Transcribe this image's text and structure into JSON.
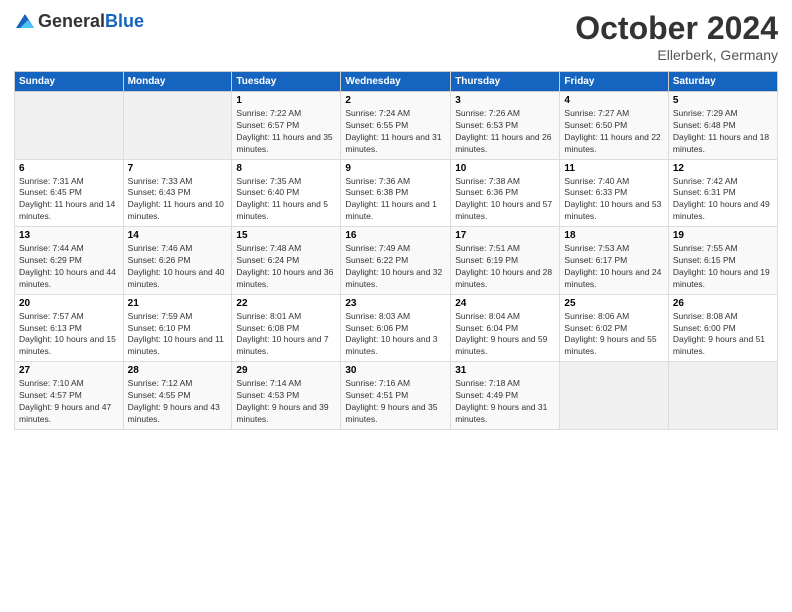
{
  "header": {
    "logo_general": "General",
    "logo_blue": "Blue",
    "month": "October 2024",
    "location": "Ellerberk, Germany"
  },
  "weekdays": [
    "Sunday",
    "Monday",
    "Tuesday",
    "Wednesday",
    "Thursday",
    "Friday",
    "Saturday"
  ],
  "weeks": [
    [
      {
        "day": "",
        "empty": true
      },
      {
        "day": "",
        "empty": true
      },
      {
        "day": "1",
        "sunrise": "7:22 AM",
        "sunset": "6:57 PM",
        "daylight": "11 hours and 35 minutes."
      },
      {
        "day": "2",
        "sunrise": "7:24 AM",
        "sunset": "6:55 PM",
        "daylight": "11 hours and 31 minutes."
      },
      {
        "day": "3",
        "sunrise": "7:26 AM",
        "sunset": "6:53 PM",
        "daylight": "11 hours and 26 minutes."
      },
      {
        "day": "4",
        "sunrise": "7:27 AM",
        "sunset": "6:50 PM",
        "daylight": "11 hours and 22 minutes."
      },
      {
        "day": "5",
        "sunrise": "7:29 AM",
        "sunset": "6:48 PM",
        "daylight": "11 hours and 18 minutes."
      }
    ],
    [
      {
        "day": "6",
        "sunrise": "7:31 AM",
        "sunset": "6:45 PM",
        "daylight": "11 hours and 14 minutes."
      },
      {
        "day": "7",
        "sunrise": "7:33 AM",
        "sunset": "6:43 PM",
        "daylight": "11 hours and 10 minutes."
      },
      {
        "day": "8",
        "sunrise": "7:35 AM",
        "sunset": "6:40 PM",
        "daylight": "11 hours and 5 minutes."
      },
      {
        "day": "9",
        "sunrise": "7:36 AM",
        "sunset": "6:38 PM",
        "daylight": "11 hours and 1 minute."
      },
      {
        "day": "10",
        "sunrise": "7:38 AM",
        "sunset": "6:36 PM",
        "daylight": "10 hours and 57 minutes."
      },
      {
        "day": "11",
        "sunrise": "7:40 AM",
        "sunset": "6:33 PM",
        "daylight": "10 hours and 53 minutes."
      },
      {
        "day": "12",
        "sunrise": "7:42 AM",
        "sunset": "6:31 PM",
        "daylight": "10 hours and 49 minutes."
      }
    ],
    [
      {
        "day": "13",
        "sunrise": "7:44 AM",
        "sunset": "6:29 PM",
        "daylight": "10 hours and 44 minutes."
      },
      {
        "day": "14",
        "sunrise": "7:46 AM",
        "sunset": "6:26 PM",
        "daylight": "10 hours and 40 minutes."
      },
      {
        "day": "15",
        "sunrise": "7:48 AM",
        "sunset": "6:24 PM",
        "daylight": "10 hours and 36 minutes."
      },
      {
        "day": "16",
        "sunrise": "7:49 AM",
        "sunset": "6:22 PM",
        "daylight": "10 hours and 32 minutes."
      },
      {
        "day": "17",
        "sunrise": "7:51 AM",
        "sunset": "6:19 PM",
        "daylight": "10 hours and 28 minutes."
      },
      {
        "day": "18",
        "sunrise": "7:53 AM",
        "sunset": "6:17 PM",
        "daylight": "10 hours and 24 minutes."
      },
      {
        "day": "19",
        "sunrise": "7:55 AM",
        "sunset": "6:15 PM",
        "daylight": "10 hours and 19 minutes."
      }
    ],
    [
      {
        "day": "20",
        "sunrise": "7:57 AM",
        "sunset": "6:13 PM",
        "daylight": "10 hours and 15 minutes."
      },
      {
        "day": "21",
        "sunrise": "7:59 AM",
        "sunset": "6:10 PM",
        "daylight": "10 hours and 11 minutes."
      },
      {
        "day": "22",
        "sunrise": "8:01 AM",
        "sunset": "6:08 PM",
        "daylight": "10 hours and 7 minutes."
      },
      {
        "day": "23",
        "sunrise": "8:03 AM",
        "sunset": "6:06 PM",
        "daylight": "10 hours and 3 minutes."
      },
      {
        "day": "24",
        "sunrise": "8:04 AM",
        "sunset": "6:04 PM",
        "daylight": "9 hours and 59 minutes."
      },
      {
        "day": "25",
        "sunrise": "8:06 AM",
        "sunset": "6:02 PM",
        "daylight": "9 hours and 55 minutes."
      },
      {
        "day": "26",
        "sunrise": "8:08 AM",
        "sunset": "6:00 PM",
        "daylight": "9 hours and 51 minutes."
      }
    ],
    [
      {
        "day": "27",
        "sunrise": "7:10 AM",
        "sunset": "4:57 PM",
        "daylight": "9 hours and 47 minutes."
      },
      {
        "day": "28",
        "sunrise": "7:12 AM",
        "sunset": "4:55 PM",
        "daylight": "9 hours and 43 minutes."
      },
      {
        "day": "29",
        "sunrise": "7:14 AM",
        "sunset": "4:53 PM",
        "daylight": "9 hours and 39 minutes."
      },
      {
        "day": "30",
        "sunrise": "7:16 AM",
        "sunset": "4:51 PM",
        "daylight": "9 hours and 35 minutes."
      },
      {
        "day": "31",
        "sunrise": "7:18 AM",
        "sunset": "4:49 PM",
        "daylight": "9 hours and 31 minutes."
      },
      {
        "day": "",
        "empty": true
      },
      {
        "day": "",
        "empty": true
      }
    ]
  ]
}
